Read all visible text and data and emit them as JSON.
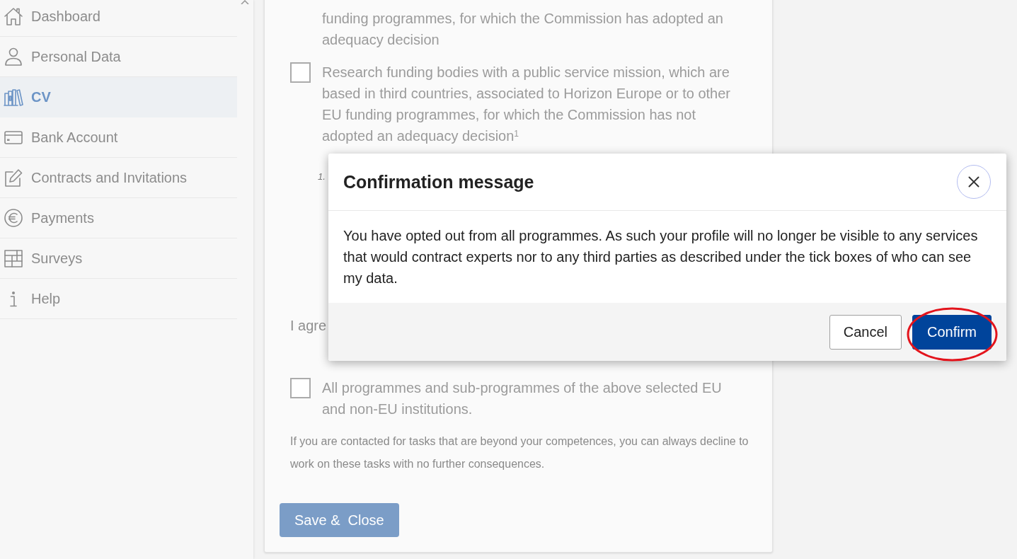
{
  "sidebar": {
    "items": [
      {
        "label": "Dashboard",
        "selected": false
      },
      {
        "label": "Personal Data",
        "selected": false
      },
      {
        "label": "CV",
        "selected": true
      },
      {
        "label": "Bank Account",
        "selected": false
      },
      {
        "label": "Contracts and Invitations",
        "selected": false
      },
      {
        "label": "Payments",
        "selected": false
      },
      {
        "label": "Surveys",
        "selected": false
      },
      {
        "label": "Help",
        "selected": false
      }
    ]
  },
  "consent_form": {
    "cut_option_text": "funding programmes, for which the Commission has adopted an adequacy decision",
    "options": [
      {
        "text": "Research funding bodies with a public service mission, which are based in third countries, associated to Horizon Europe or to other EU funding programmes, for which the Commission has not adopted an adequacy decision$^{1}$",
        "checked": false
      }
    ],
    "footnote_marker": "1.",
    "agreement_text": "I agre",
    "programme_options": [
      {
        "text": "All programmes and sub-programmes of the above selected EU and non-EU institutions.",
        "checked": false
      }
    ],
    "note": "If you are contacted for tasks that are beyond your competences, you can always decline to work on these tasks with no further consequences.",
    "save_button": "Save &  Close"
  },
  "modal": {
    "title": "Confirmation message",
    "message": "You have opted out from all programmes. As such your profile will no longer be visible to any services that would contract experts nor to any third parties as described under the tick boxes of who can see my data.",
    "buttons": [
      {
        "label": "Cancel",
        "kind": "secondary",
        "highlighted": false
      },
      {
        "label": "Confirm",
        "kind": "primary",
        "highlighted": true
      }
    ]
  }
}
